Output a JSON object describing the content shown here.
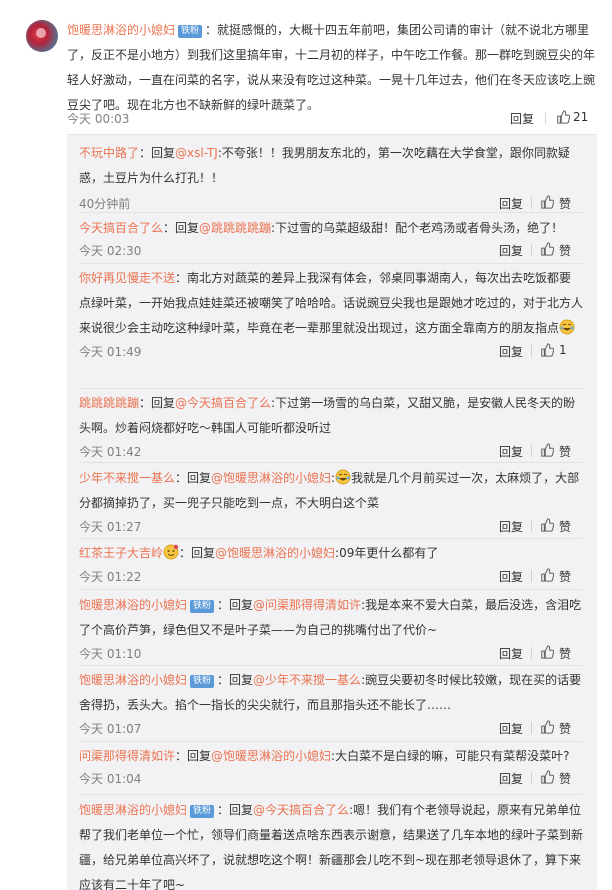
{
  "main_comment": {
    "username": "饱暖思淋浴的小媳妇",
    "badge": "铁粉",
    "text": "：就挺感慨的，大概十四五年前吧，集团公司请的审计（就不说北方哪里了，反正不是小地方）到我们这里搞年审，十二月初的样子，中午吃工作餐。那一群吃到豌豆尖的年轻人好激动，一直在问菜的名字，说从来没有吃过这种菜。一晃十几年过去，他们在冬天应该吃上豌豆尖了吧。现在北方也不缺新鲜的绿叶蔬菜了。",
    "time": "今天 00:03",
    "reply_label": "回复",
    "like_count": "21"
  },
  "sub_comments": [
    {
      "username": "不玩中路了",
      "badge": "",
      "reply_prefix": "：回复",
      "mention": "@xsl-TJ",
      "text": ":不夸张！！我男朋友东北的，第一次吃藕在大学食堂，跟你同款疑惑，土豆片为什么打孔！！",
      "time": "40分钟前",
      "reply_label": "回复",
      "like_label": "赞"
    },
    {
      "username": "今天搞百合了么",
      "badge": "",
      "reply_prefix": "：回复",
      "mention": "@跳跳跳跳蹦",
      "text": ":下过雪的乌菜超级甜！配个老鸡汤或者骨头汤，绝了！",
      "time": "今天 02:30",
      "reply_label": "回复",
      "like_label": "赞"
    },
    {
      "username": "你好再见慢走不送",
      "badge": "",
      "reply_prefix": "",
      "mention": "",
      "text": "：南北方对蔬菜的差异上我深有体会，邻桌同事湖南人，每次出去吃饭都要点绿叶菜，一开始我点娃娃菜还被嘲笑了哈哈哈。话说豌豆尖我也是跟她才吃过的，对于北方人来说很少会主动吃这种绿叶菜，毕竟在老一辈那里就没出现过，这方面全靠南方的朋友指点",
      "emoji": "laugh-cry-emoji",
      "time": "今天 01:49",
      "reply_label": "回复",
      "like_label": "1"
    },
    {
      "username": "跳跳跳跳蹦",
      "badge": "",
      "reply_prefix": "：回复",
      "mention": "@今天搞百合了么",
      "text": ":下过第一场雪的乌白菜，又甜又脆，是安徽人民冬天的盼头啊。炒着闷烧都好吃～韩国人可能听都没听过",
      "time": "今天 01:42",
      "reply_label": "回复",
      "like_label": "赞"
    },
    {
      "username": "少年不来搅一基么",
      "badge": "",
      "reply_prefix": "：回复",
      "mention": "@饱暖思淋浴的小媳妇",
      "text": "我就是几个月前买过一次，太麻烦了，大部分都摘掉扔了，买一兜子只能吃到一点，不大明白这个菜",
      "emoji": "laugh-cry-emoji",
      "time": "今天 01:27",
      "reply_label": "回复",
      "like_label": "赞"
    },
    {
      "username": "红茶王子大吉岭",
      "badge": "",
      "reply_prefix": "：回复",
      "mention": "@饱暖思淋浴的小媳妇",
      "text": ":09年更什么都有了",
      "emoji": "flower-emoji",
      "time": "今天 01:22",
      "reply_label": "回复",
      "like_label": "赞"
    },
    {
      "username": "饱暖思淋浴的小媳妇",
      "badge": "铁粉",
      "reply_prefix": "：回复",
      "mention": "@问渠那得得清如许",
      "text": ":我是本来不爱大白菜，最后没选，含泪吃了个高价芦笋，绿色但又不是叶子菜——为自己的挑嘴付出了代价~",
      "time": "今天 01:10",
      "reply_label": "回复",
      "like_label": "赞"
    },
    {
      "username": "饱暖思淋浴的小媳妇",
      "badge": "铁粉",
      "reply_prefix": "：回复",
      "mention": "@少年不来搅一基么",
      "text": ":豌豆尖要初冬时候比较嫩，现在买的话要舍得扔，丢头大。掐个一指长的尖尖就行，而且那指头还不能长了……",
      "time": "今天 01:07",
      "reply_label": "回复",
      "like_label": "赞"
    },
    {
      "username": "问渠那得得清如许",
      "badge": "",
      "reply_prefix": "：回复",
      "mention": "@饱暖思淋浴的小媳妇",
      "text": ":大白菜不是白绿的嘛，可能只有菜帮没菜叶?",
      "time": "今天 01:04",
      "reply_label": "回复",
      "like_label": "赞"
    },
    {
      "username": "饱暖思淋浴的小媳妇",
      "badge": "铁粉",
      "reply_prefix": "：回复",
      "mention": "@今天搞百合了么",
      "text": ":嗯！我们有个老领导说起，原来有兄弟单位帮了我们老单位一个忙，领导们商量着送点啥东西表示谢意，结果送了几车本地的绿叶子菜到新疆，给兄弟单位高兴坏了，说就想吃这个啊！新疆那会儿吃不到~现在那老领导退休了，算下来应该有二十年了吧~",
      "time": "",
      "reply_label": "",
      "like_label": ""
    }
  ],
  "colors": {
    "username": "#eb7350",
    "badge_bg": "#5a9ad8",
    "panel_bg": "#f2f2f5"
  }
}
